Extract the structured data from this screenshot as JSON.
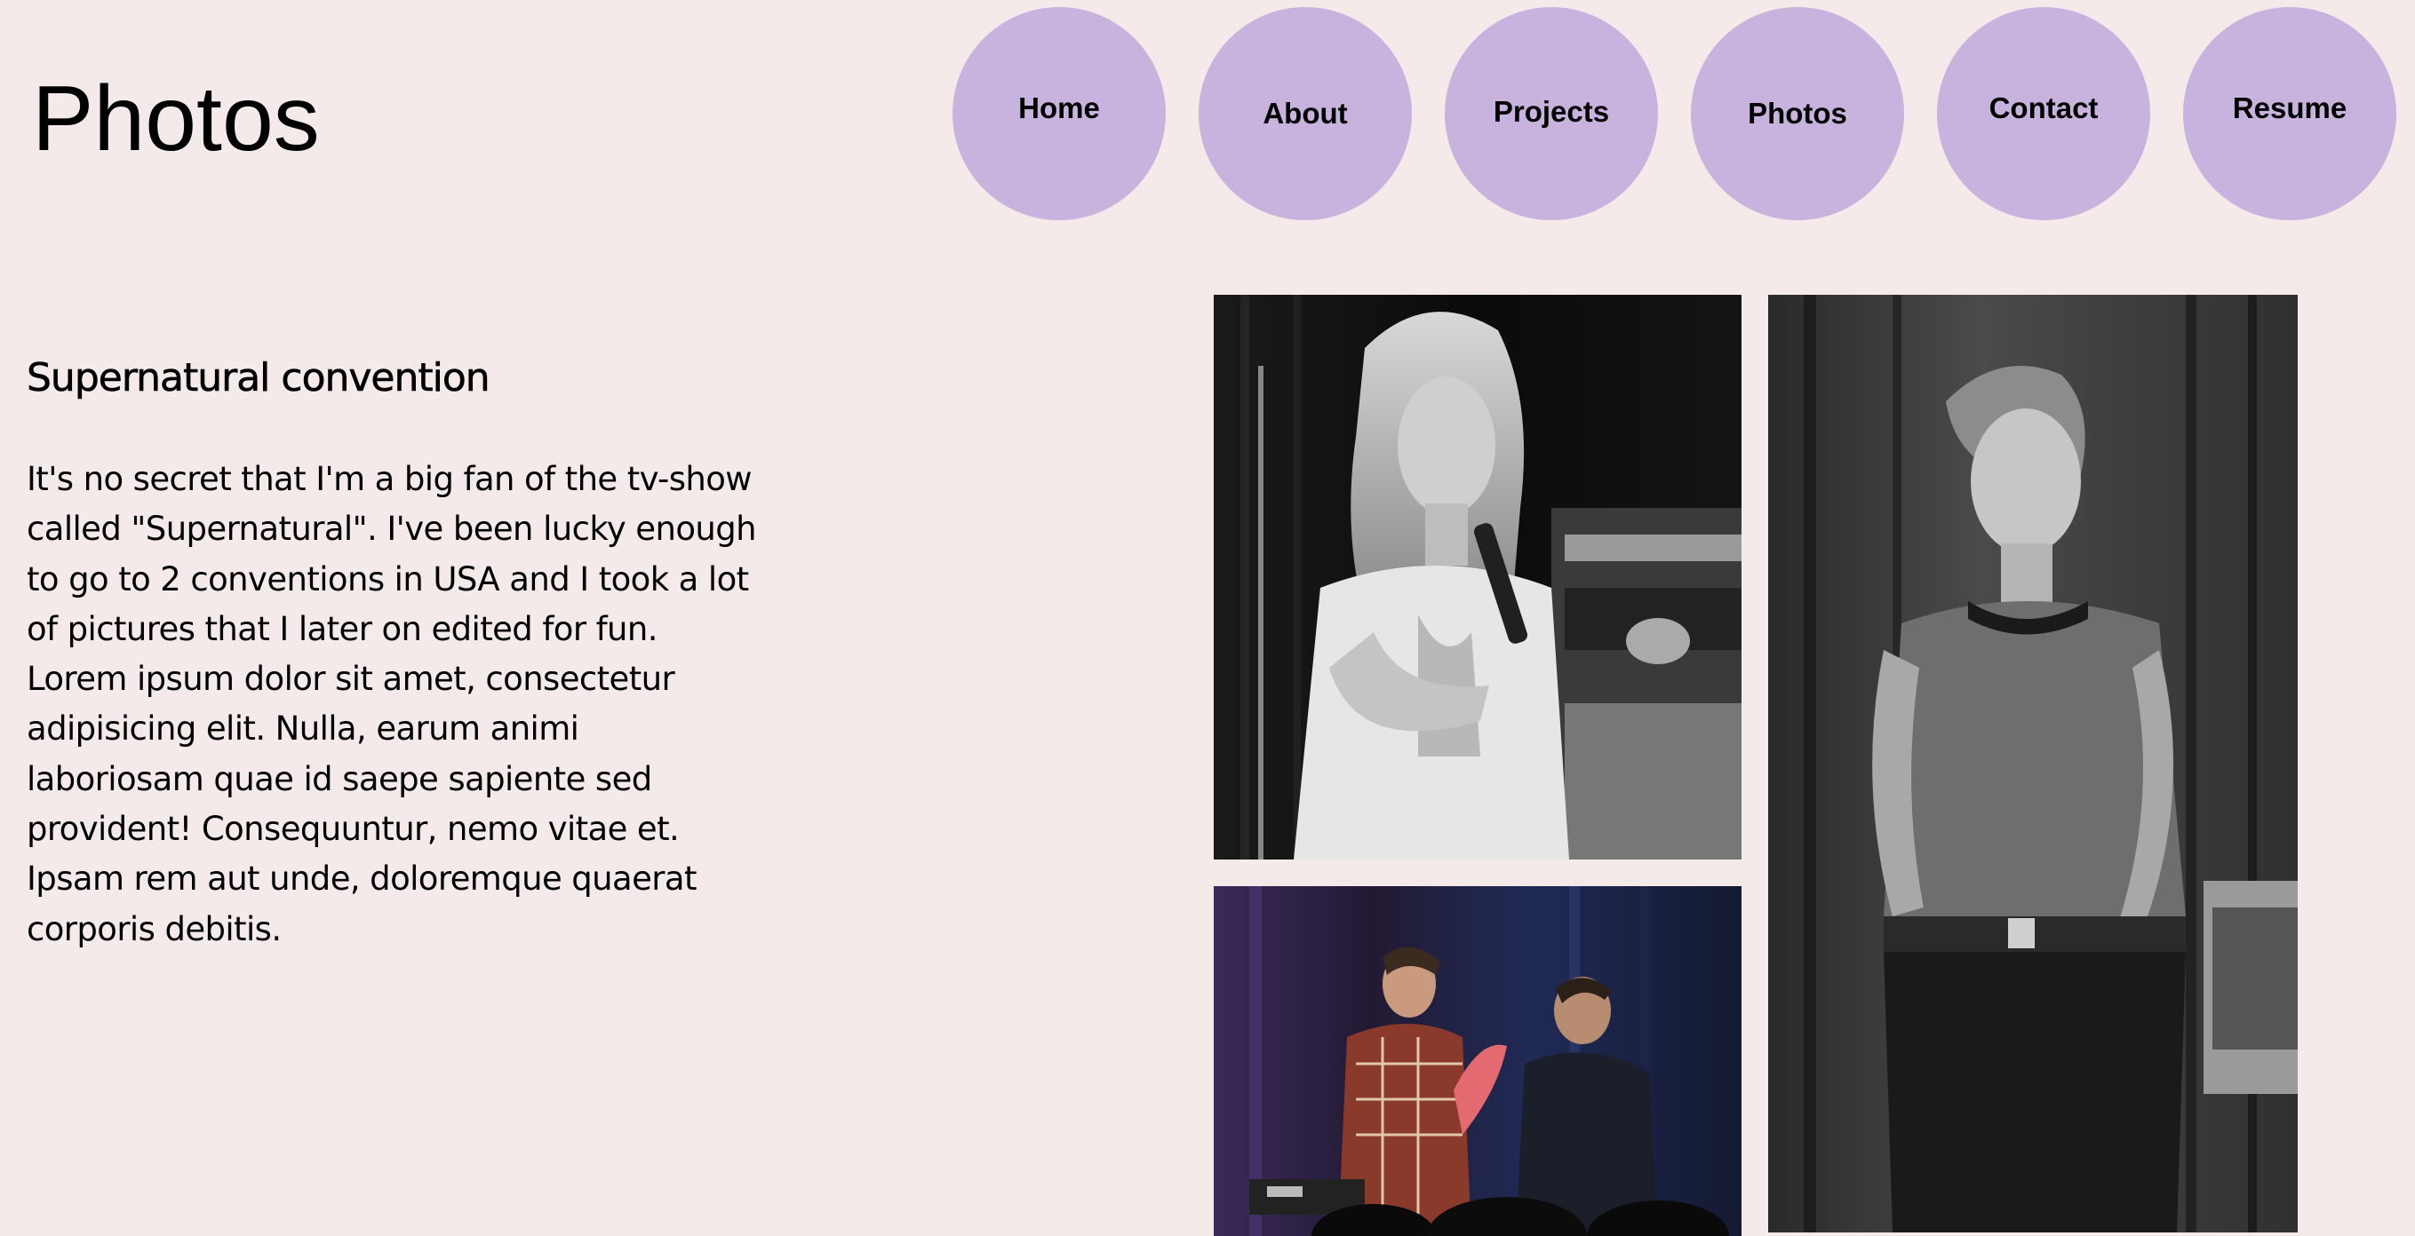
{
  "page": {
    "title": "Photos"
  },
  "nav": {
    "items": [
      {
        "label": "Home"
      },
      {
        "label": "About"
      },
      {
        "label": "Projects"
      },
      {
        "label": "Photos"
      },
      {
        "label": "Contact"
      },
      {
        "label": "Resume"
      }
    ]
  },
  "section": {
    "heading": "Supernatural convention",
    "body": "It's no secret that I'm a big fan of the tv-show called \"Supernatural\". I've been lucky enough to go to 2 conventions in USA and I took a lot of pictures that I later on edited for fun. Lorem ipsum dolor sit amet, consectetur adipisicing elit. Nulla, earum animi laboriosam quae id saepe sapiente sed provident! Consequuntur, nemo vitae et. Ipsam rem aut unde, doloremque quaerat corporis debitis."
  },
  "photos": [
    {
      "name": "woman-with-microphone-photo"
    },
    {
      "name": "two-men-on-stage-photo"
    },
    {
      "name": "woman-smiling-photo"
    }
  ],
  "colors": {
    "background": "#f4eaea",
    "nav_circle": "#c8b3df"
  }
}
